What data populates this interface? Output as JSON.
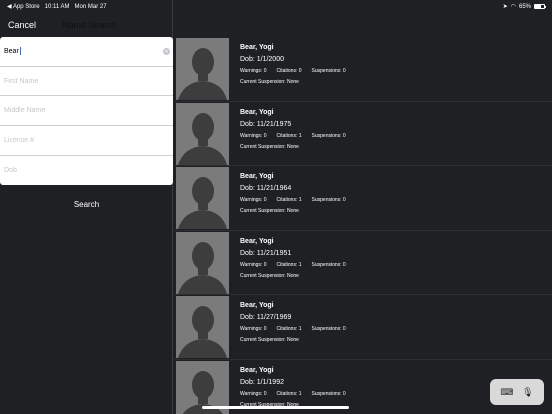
{
  "status": {
    "back_app": "◀ App Store",
    "time": "10:11 AM",
    "date": "Mon Mar 27",
    "battery_pct": "65%"
  },
  "nav": {
    "cancel": "Cancel",
    "title": "Name Search"
  },
  "form": {
    "last_name": "Bear",
    "first_name_placeholder": "First Name",
    "middle_name_placeholder": "Middle Name",
    "license_placeholder": "License #",
    "dob_placeholder": "Dob"
  },
  "search_label": "Search",
  "results": [
    {
      "name": "Bear, Yogi",
      "dob": "Dob: 1/1/2000",
      "warnings": "Warnings: 0",
      "citations": "Citations: 0",
      "suspensions": "Suspensions: 0",
      "current": "Current Suspension: None"
    },
    {
      "name": "Bear, Yogi",
      "dob": "Dob: 11/21/1975",
      "warnings": "Warnings: 0",
      "citations": "Citations: 1",
      "suspensions": "Suspensions: 0",
      "current": "Current Suspension: None"
    },
    {
      "name": "Bear, Yogi",
      "dob": "Dob: 11/21/1964",
      "warnings": "Warnings: 0",
      "citations": "Citations: 1",
      "suspensions": "Suspensions: 0",
      "current": "Current Suspension: None"
    },
    {
      "name": "Bear, Yogi",
      "dob": "Dob: 11/21/1951",
      "warnings": "Warnings: 0",
      "citations": "Citations: 1",
      "suspensions": "Suspensions: 0",
      "current": "Current Suspension: None"
    },
    {
      "name": "Bear, Yogi",
      "dob": "Dob: 11/27/1969",
      "warnings": "Warnings: 0",
      "citations": "Citations: 1",
      "suspensions": "Suspensions: 0",
      "current": "Current Suspension: None"
    },
    {
      "name": "Bear, Yogi",
      "dob": "Dob: 1/1/1992",
      "warnings": "Warnings: 0",
      "citations": "Citations: 1",
      "suspensions": "Suspensions: 0",
      "current": "Current Suspension: None"
    }
  ],
  "icons": {
    "clear": "clear-icon",
    "keyboard": "keyboard-icon",
    "mic": "mic-icon"
  }
}
